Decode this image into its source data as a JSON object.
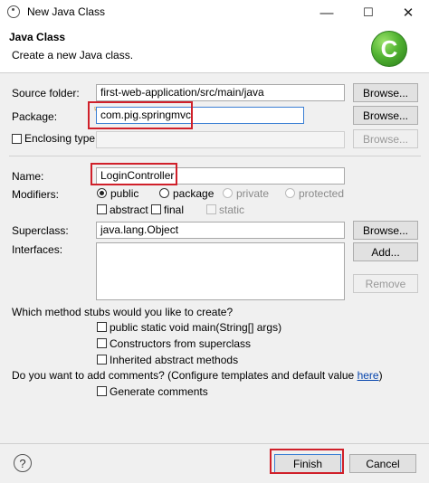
{
  "window": {
    "title": "New Java Class"
  },
  "banner": {
    "title": "Java Class",
    "subtitle": "Create a new Java class."
  },
  "source_folder": {
    "label": "Source folder:",
    "value": "first-web-application/src/main/java",
    "browse": "Browse..."
  },
  "package": {
    "label": "Package:",
    "value": "com.pig.springmvc",
    "browse": "Browse..."
  },
  "enclosing": {
    "label": "Enclosing type:",
    "value": "",
    "browse": "Browse..."
  },
  "name": {
    "label": "Name:",
    "value": "LoginController"
  },
  "modifiers": {
    "label": "Modifiers:",
    "public": "public",
    "package": "package",
    "private": "private",
    "protected": "protected",
    "abstract": "abstract",
    "final": "final",
    "static": "static"
  },
  "superclass": {
    "label": "Superclass:",
    "value": "java.lang.Object",
    "browse": "Browse..."
  },
  "interfaces": {
    "label": "Interfaces:",
    "add": "Add...",
    "remove": "Remove"
  },
  "stubs": {
    "question": "Which method stubs would you like to create?",
    "main": "public static void main(String[] args)",
    "constructors": "Constructors from superclass",
    "inherited": "Inherited abstract methods"
  },
  "comments": {
    "question": "Do you want to add comments? (Configure templates and default value ",
    "link": "here",
    "close": ")",
    "generate": "Generate comments"
  },
  "footer": {
    "help": "?",
    "finish": "Finish",
    "cancel": "Cancel"
  },
  "titlebar": {
    "minimize": "—",
    "maximize": "☐",
    "close": "✕"
  },
  "logo_letter": "C"
}
